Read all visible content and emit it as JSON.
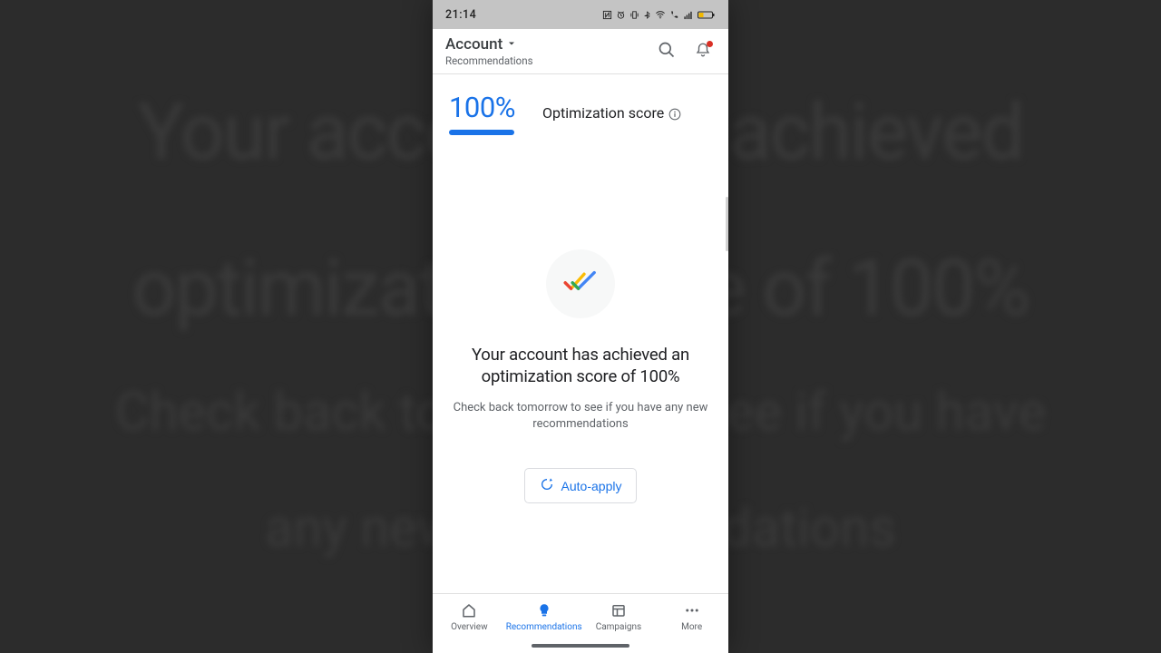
{
  "statusbar": {
    "time": "21:14"
  },
  "appbar": {
    "title": "Account",
    "subtitle": "Recommendations"
  },
  "score": {
    "value": "100%",
    "label": "Optimization score"
  },
  "main": {
    "headline": "Your account has achieved an optimization score of 100%",
    "subline": "Check back tomorrow to see if you have any new recommendations",
    "auto_apply_label": "Auto-apply"
  },
  "nav": {
    "items": [
      {
        "label": "Overview"
      },
      {
        "label": "Recommendations"
      },
      {
        "label": "Campaigns"
      },
      {
        "label": "More"
      }
    ]
  },
  "bg": {
    "line1a": "Your account has achieved an",
    "line1b": "optimization score of 100%",
    "line2a": "Check back tomorrow to see if you have",
    "line2b": "any new recommendations"
  },
  "colors": {
    "accent": "#1a73e8"
  }
}
